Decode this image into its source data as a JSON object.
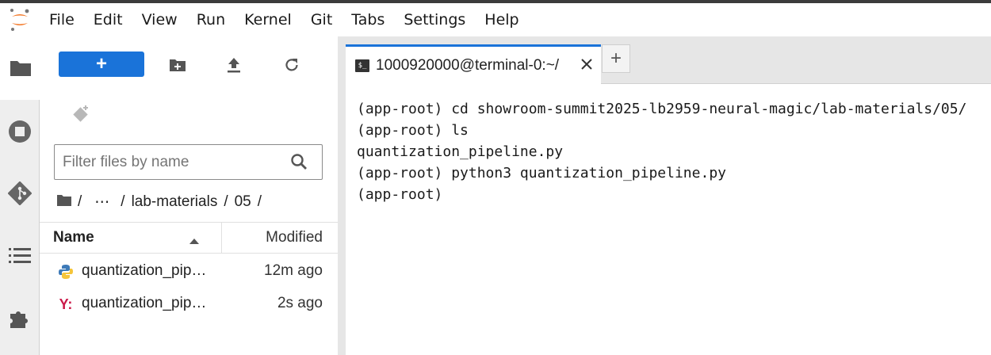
{
  "menubar": {
    "items": [
      "File",
      "Edit",
      "View",
      "Run",
      "Kernel",
      "Git",
      "Tabs",
      "Settings",
      "Help"
    ]
  },
  "activity_bar": {
    "icons": [
      "folder-icon",
      "stop-circle-icon",
      "git-icon",
      "list-icon",
      "puzzle-icon"
    ],
    "active": "folder-icon"
  },
  "file_browser": {
    "new_button_label": "+",
    "filter_placeholder": "Filter files by name",
    "breadcrumb": {
      "sep1": "/",
      "ellipsis": "⋯",
      "sep2": "/",
      "dir1": "lab-materials",
      "sep3": "/",
      "dir2": "05",
      "sep4": "/"
    },
    "columns": {
      "name": "Name",
      "modified": "Modified"
    },
    "files": [
      {
        "name": "quantization_pip…",
        "modified": "12m ago",
        "icon": "python-file-icon"
      },
      {
        "name": "quantization_pip…",
        "modified": "2s ago",
        "icon": "yaml-file-icon"
      }
    ]
  },
  "tabs": {
    "active_label": "1000920000@terminal-0:~/",
    "add_label": "+"
  },
  "terminal": {
    "lines": [
      "(app-root) cd showroom-summit2025-lb2959-neural-magic/lab-materials/05/",
      "(app-root) ls",
      "quantization_pipeline.py",
      "(app-root) python3 quantization_pipeline.py",
      "(app-root) "
    ]
  },
  "colors": {
    "accent": "#1a73d9",
    "jupyter_orange": "#f37726",
    "yaml_red": "#cb1a4a"
  }
}
